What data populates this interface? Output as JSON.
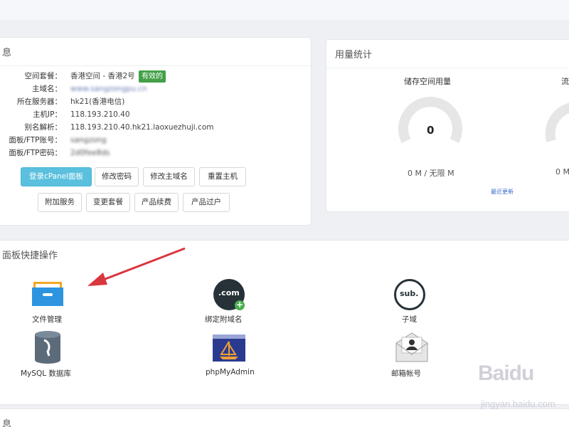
{
  "info": {
    "title": "息",
    "rows": [
      {
        "label": "空间套餐：",
        "value": "香港空间 - 香港2号",
        "badge": "有效的"
      },
      {
        "label": "主域名：",
        "value": "www.sangzongpu.cn",
        "blurred": true
      },
      {
        "label": "所在服务器：",
        "value": "hk21(香港电信)"
      },
      {
        "label": "主机IP：",
        "value": "118.193.210.40"
      },
      {
        "label": "别名解析：",
        "value": "118.193.210.40.hk21.laoxuezhuji.com"
      },
      {
        "label": "面板/FTP账号：",
        "value": "sangzong",
        "blurred": true
      },
      {
        "label": "面板/FTP密码：",
        "value": "2d0fee8ds",
        "blurred": true
      }
    ],
    "buttons_row1": [
      "登录cPanel面板",
      "修改密码",
      "修改主域名",
      "重置主机"
    ],
    "buttons_row2": [
      "附加服务",
      "变更套餐",
      "产品续费",
      "产品过户"
    ]
  },
  "usage": {
    "title": "用量统计",
    "gauges": [
      {
        "title": "储存空间用量",
        "value": "0",
        "caption": "0 M / 无限 M",
        "link": "最近更新"
      },
      {
        "title": "流",
        "value": "0",
        "caption": "0 M"
      }
    ]
  },
  "quick": {
    "title": "面板快捷操作",
    "apps": [
      {
        "label": "文件管理",
        "icon": "file-manager-icon"
      },
      {
        "label": "绑定附域名",
        "icon": "addon-domain-icon",
        "icon_text": ".com"
      },
      {
        "label": "子域",
        "icon": "subdomain-icon",
        "icon_text": "sub."
      },
      {
        "label": "MySQL 数据库",
        "icon": "mysql-database-icon"
      },
      {
        "label": "phpMyAdmin",
        "icon": "phpmyadmin-icon"
      },
      {
        "label": "邮箱帐号",
        "icon": "email-accounts-icon"
      }
    ]
  },
  "bottom": {
    "title": "息"
  },
  "watermark": {
    "brand": "Baidu",
    "url": "jingyan.baidu.com"
  },
  "colors": {
    "primary_button": "#5bc0de",
    "badge": "#43a047",
    "arrow": "#d9363e"
  }
}
